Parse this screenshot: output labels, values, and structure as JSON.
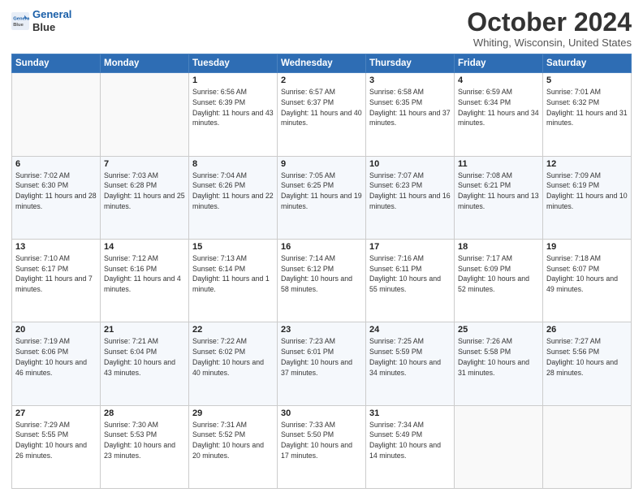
{
  "header": {
    "logo_line1": "General",
    "logo_line2": "Blue",
    "month_title": "October 2024",
    "location": "Whiting, Wisconsin, United States"
  },
  "weekdays": [
    "Sunday",
    "Monday",
    "Tuesday",
    "Wednesday",
    "Thursday",
    "Friday",
    "Saturday"
  ],
  "weeks": [
    [
      {
        "day": "",
        "sunrise": "",
        "sunset": "",
        "daylight": ""
      },
      {
        "day": "",
        "sunrise": "",
        "sunset": "",
        "daylight": ""
      },
      {
        "day": "1",
        "sunrise": "Sunrise: 6:56 AM",
        "sunset": "Sunset: 6:39 PM",
        "daylight": "Daylight: 11 hours and 43 minutes."
      },
      {
        "day": "2",
        "sunrise": "Sunrise: 6:57 AM",
        "sunset": "Sunset: 6:37 PM",
        "daylight": "Daylight: 11 hours and 40 minutes."
      },
      {
        "day": "3",
        "sunrise": "Sunrise: 6:58 AM",
        "sunset": "Sunset: 6:35 PM",
        "daylight": "Daylight: 11 hours and 37 minutes."
      },
      {
        "day": "4",
        "sunrise": "Sunrise: 6:59 AM",
        "sunset": "Sunset: 6:34 PM",
        "daylight": "Daylight: 11 hours and 34 minutes."
      },
      {
        "day": "5",
        "sunrise": "Sunrise: 7:01 AM",
        "sunset": "Sunset: 6:32 PM",
        "daylight": "Daylight: 11 hours and 31 minutes."
      }
    ],
    [
      {
        "day": "6",
        "sunrise": "Sunrise: 7:02 AM",
        "sunset": "Sunset: 6:30 PM",
        "daylight": "Daylight: 11 hours and 28 minutes."
      },
      {
        "day": "7",
        "sunrise": "Sunrise: 7:03 AM",
        "sunset": "Sunset: 6:28 PM",
        "daylight": "Daylight: 11 hours and 25 minutes."
      },
      {
        "day": "8",
        "sunrise": "Sunrise: 7:04 AM",
        "sunset": "Sunset: 6:26 PM",
        "daylight": "Daylight: 11 hours and 22 minutes."
      },
      {
        "day": "9",
        "sunrise": "Sunrise: 7:05 AM",
        "sunset": "Sunset: 6:25 PM",
        "daylight": "Daylight: 11 hours and 19 minutes."
      },
      {
        "day": "10",
        "sunrise": "Sunrise: 7:07 AM",
        "sunset": "Sunset: 6:23 PM",
        "daylight": "Daylight: 11 hours and 16 minutes."
      },
      {
        "day": "11",
        "sunrise": "Sunrise: 7:08 AM",
        "sunset": "Sunset: 6:21 PM",
        "daylight": "Daylight: 11 hours and 13 minutes."
      },
      {
        "day": "12",
        "sunrise": "Sunrise: 7:09 AM",
        "sunset": "Sunset: 6:19 PM",
        "daylight": "Daylight: 11 hours and 10 minutes."
      }
    ],
    [
      {
        "day": "13",
        "sunrise": "Sunrise: 7:10 AM",
        "sunset": "Sunset: 6:17 PM",
        "daylight": "Daylight: 11 hours and 7 minutes."
      },
      {
        "day": "14",
        "sunrise": "Sunrise: 7:12 AM",
        "sunset": "Sunset: 6:16 PM",
        "daylight": "Daylight: 11 hours and 4 minutes."
      },
      {
        "day": "15",
        "sunrise": "Sunrise: 7:13 AM",
        "sunset": "Sunset: 6:14 PM",
        "daylight": "Daylight: 11 hours and 1 minute."
      },
      {
        "day": "16",
        "sunrise": "Sunrise: 7:14 AM",
        "sunset": "Sunset: 6:12 PM",
        "daylight": "Daylight: 10 hours and 58 minutes."
      },
      {
        "day": "17",
        "sunrise": "Sunrise: 7:16 AM",
        "sunset": "Sunset: 6:11 PM",
        "daylight": "Daylight: 10 hours and 55 minutes."
      },
      {
        "day": "18",
        "sunrise": "Sunrise: 7:17 AM",
        "sunset": "Sunset: 6:09 PM",
        "daylight": "Daylight: 10 hours and 52 minutes."
      },
      {
        "day": "19",
        "sunrise": "Sunrise: 7:18 AM",
        "sunset": "Sunset: 6:07 PM",
        "daylight": "Daylight: 10 hours and 49 minutes."
      }
    ],
    [
      {
        "day": "20",
        "sunrise": "Sunrise: 7:19 AM",
        "sunset": "Sunset: 6:06 PM",
        "daylight": "Daylight: 10 hours and 46 minutes."
      },
      {
        "day": "21",
        "sunrise": "Sunrise: 7:21 AM",
        "sunset": "Sunset: 6:04 PM",
        "daylight": "Daylight: 10 hours and 43 minutes."
      },
      {
        "day": "22",
        "sunrise": "Sunrise: 7:22 AM",
        "sunset": "Sunset: 6:02 PM",
        "daylight": "Daylight: 10 hours and 40 minutes."
      },
      {
        "day": "23",
        "sunrise": "Sunrise: 7:23 AM",
        "sunset": "Sunset: 6:01 PM",
        "daylight": "Daylight: 10 hours and 37 minutes."
      },
      {
        "day": "24",
        "sunrise": "Sunrise: 7:25 AM",
        "sunset": "Sunset: 5:59 PM",
        "daylight": "Daylight: 10 hours and 34 minutes."
      },
      {
        "day": "25",
        "sunrise": "Sunrise: 7:26 AM",
        "sunset": "Sunset: 5:58 PM",
        "daylight": "Daylight: 10 hours and 31 minutes."
      },
      {
        "day": "26",
        "sunrise": "Sunrise: 7:27 AM",
        "sunset": "Sunset: 5:56 PM",
        "daylight": "Daylight: 10 hours and 28 minutes."
      }
    ],
    [
      {
        "day": "27",
        "sunrise": "Sunrise: 7:29 AM",
        "sunset": "Sunset: 5:55 PM",
        "daylight": "Daylight: 10 hours and 26 minutes."
      },
      {
        "day": "28",
        "sunrise": "Sunrise: 7:30 AM",
        "sunset": "Sunset: 5:53 PM",
        "daylight": "Daylight: 10 hours and 23 minutes."
      },
      {
        "day": "29",
        "sunrise": "Sunrise: 7:31 AM",
        "sunset": "Sunset: 5:52 PM",
        "daylight": "Daylight: 10 hours and 20 minutes."
      },
      {
        "day": "30",
        "sunrise": "Sunrise: 7:33 AM",
        "sunset": "Sunset: 5:50 PM",
        "daylight": "Daylight: 10 hours and 17 minutes."
      },
      {
        "day": "31",
        "sunrise": "Sunrise: 7:34 AM",
        "sunset": "Sunset: 5:49 PM",
        "daylight": "Daylight: 10 hours and 14 minutes."
      },
      {
        "day": "",
        "sunrise": "",
        "sunset": "",
        "daylight": ""
      },
      {
        "day": "",
        "sunrise": "",
        "sunset": "",
        "daylight": ""
      }
    ]
  ]
}
